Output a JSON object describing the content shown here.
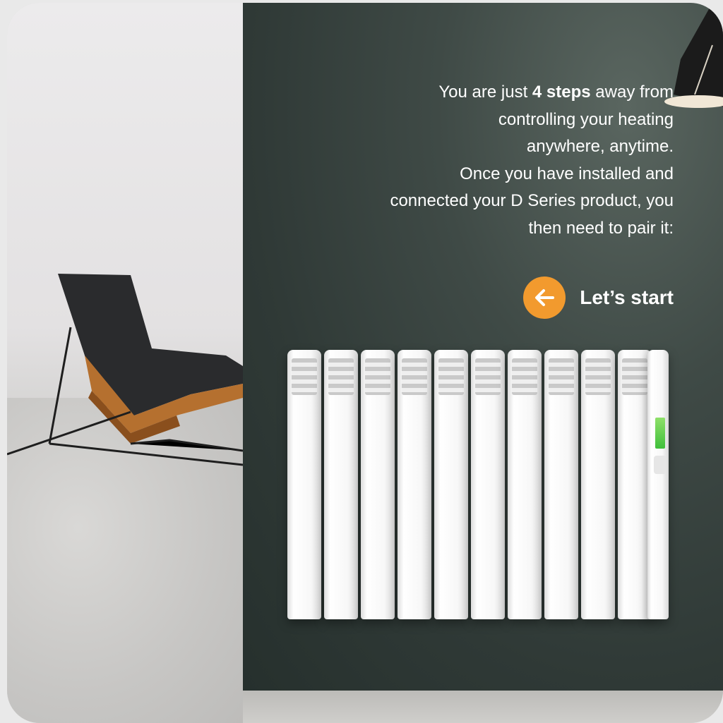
{
  "intro": {
    "line1_pre": "You are just ",
    "line1_bold": "4 steps",
    "line1_post": " away from",
    "line2": "controlling your heating",
    "line3": "anywhere, anytime.",
    "line4": "Once you have installed and",
    "line5": "connected your D Series product, you",
    "line6": "then need to pair it:"
  },
  "cta": {
    "label": "Let’s start",
    "icon": "arrow-left-icon"
  },
  "colors": {
    "accent": "#f29a2e",
    "wall": "#3f4a46",
    "text": "#ffffff"
  }
}
